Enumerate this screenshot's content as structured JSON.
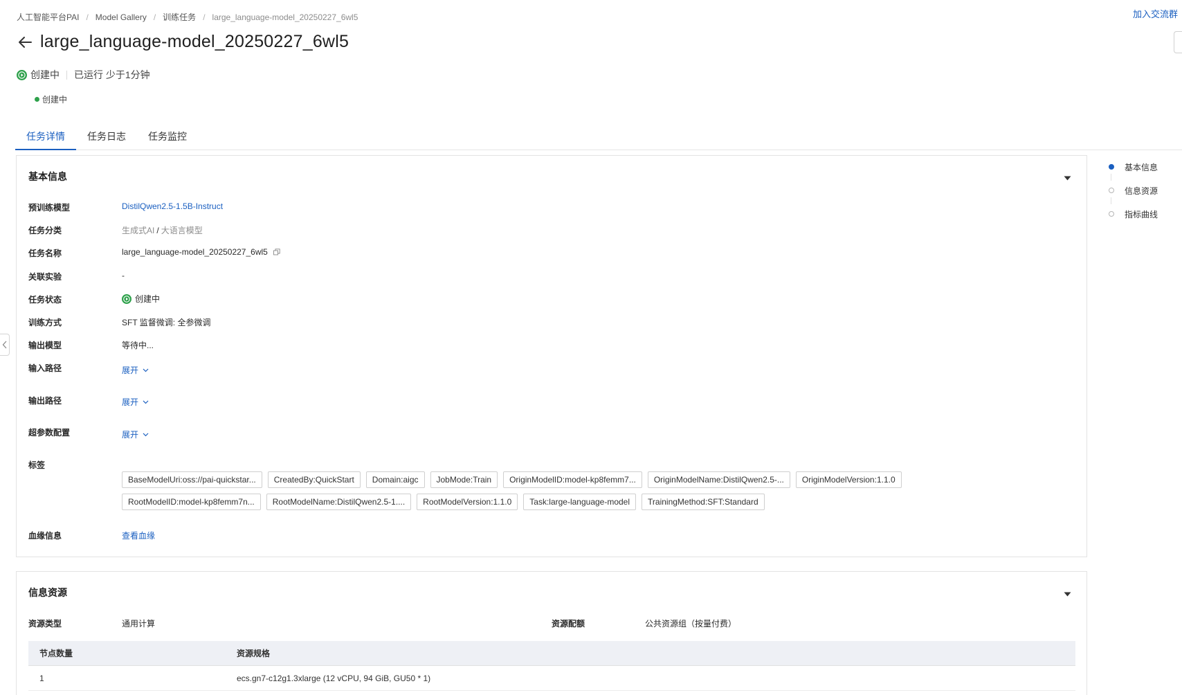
{
  "breadcrumb": [
    "人工智能平台PAI",
    "Model Gallery",
    "训练任务",
    "large_language-model_20250227_6wl5"
  ],
  "join_link": "加入交流群",
  "page_title": "large_language-model_20250227_6wl5",
  "status": {
    "label": "创建中",
    "runtime": "已运行 少于1分钟",
    "sub_label": "创建中",
    "color": "#2ea14b"
  },
  "tabs": [
    "任务详情",
    "任务日志",
    "任务监控"
  ],
  "basic_info": {
    "title": "基本信息",
    "pretrained_model": {
      "label": "预训练模型",
      "value": "DistilQwen2.5-1.5B-Instruct"
    },
    "task_category": {
      "label": "任务分类",
      "primary": "生成式AI",
      "separator": "/",
      "secondary": "大语言模型"
    },
    "task_name": {
      "label": "任务名称",
      "value": "large_language-model_20250227_6wl5"
    },
    "related_experiment": {
      "label": "关联实验",
      "value": "-"
    },
    "task_status": {
      "label": "任务状态",
      "value": "创建中"
    },
    "training_method": {
      "label": "训练方式",
      "value": "SFT 监督微调: 全参微调"
    },
    "output_model": {
      "label": "输出模型",
      "value": "等待中..."
    },
    "input_path": {
      "label": "输入路径",
      "action": "展开"
    },
    "output_path": {
      "label": "输出路径",
      "action": "展开"
    },
    "hyperparams": {
      "label": "超参数配置",
      "action": "展开"
    },
    "tags": {
      "label": "标签",
      "items": [
        "BaseModelUri:oss://pai-quickstar...",
        "CreatedBy:QuickStart",
        "Domain:aigc",
        "JobMode:Train",
        "OriginModelID:model-kp8femm7...",
        "OriginModelName:DistilQwen2.5-...",
        "OriginModelVersion:1.1.0",
        "RootModelID:model-kp8femm7n...",
        "RootModelName:DistilQwen2.5-1....",
        "RootModelVersion:1.1.0",
        "Task:large-language-model",
        "TrainingMethod:SFT:Standard"
      ]
    },
    "lineage": {
      "label": "血缘信息",
      "value": "查看血缘"
    }
  },
  "resource_info": {
    "title": "信息资源",
    "resource_type": {
      "label": "资源类型",
      "value": "通用计算"
    },
    "resource_quota": {
      "label": "资源配额",
      "value": "公共资源组（按量付费）"
    },
    "table": {
      "headers": [
        "节点数量",
        "资源规格"
      ],
      "rows": [
        [
          "1",
          "ecs.gn7-c12g1.3xlarge (12 vCPU, 94 GiB, GU50 * 1)"
        ]
      ]
    }
  },
  "anchor_nav": [
    "基本信息",
    "信息资源",
    "指标曲线"
  ],
  "accent_color": "#1a5fc0"
}
